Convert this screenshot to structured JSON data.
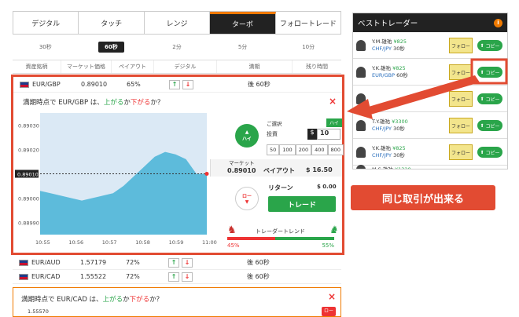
{
  "tabs": [
    "デジタル",
    "タッチ",
    "レンジ",
    "ターボ",
    "フォロートレード"
  ],
  "times": [
    "30秒",
    "60秒",
    "2分",
    "5分",
    "10分"
  ],
  "columns": [
    "資産銘柄",
    "マーケット価格",
    "ペイアウト",
    "デジタル",
    "満期",
    "残り時間"
  ],
  "main_row": {
    "pair": "EUR/GBP",
    "price": "0.89010",
    "payout": "65%",
    "expiry": "後 60秒"
  },
  "question": {
    "prefix": "満期時点で EUR/GBP は、",
    "up": "上がる",
    "mid": "か",
    "down": "下がる",
    "suffix": "か？"
  },
  "chart_data": {
    "type": "line",
    "x": [
      "10:55",
      "10:56",
      "10:57",
      "10:58",
      "10:59",
      "11:00"
    ],
    "yticks": [
      "0.89030",
      "0.89020",
      "0.89010",
      "0.89000",
      "0.88990"
    ],
    "current_label": "0.89010",
    "values": [
      0.89003,
      0.89002,
      0.89001,
      0.89,
      0.88999,
      0.89,
      0.89001,
      0.89002,
      0.89005,
      0.89009,
      0.89013,
      0.89017,
      0.89019,
      0.89018,
      0.89016,
      0.8901,
      0.8901
    ]
  },
  "market": {
    "label": "マーケット",
    "value": "0.89010"
  },
  "payout": {
    "label": "ペイアウト",
    "value": "$ 16.50"
  },
  "return": {
    "label": "リターン",
    "value": "$ 0.00"
  },
  "high_label": "ハイ",
  "low_label": "ロー",
  "select_label": "ご選択",
  "select_value": "ハイ",
  "invest_label": "投資",
  "invest_currency": "$",
  "invest_value": "10",
  "amounts": [
    "50",
    "100",
    "200",
    "400",
    "800"
  ],
  "trade_label": "トレード",
  "trend": {
    "label": "トレーダートレンド",
    "left": "45%",
    "right": "55%",
    "left_value": 0.45
  },
  "rows": [
    {
      "pair": "EUR/AUD",
      "price": "1.57179",
      "payout": "72%",
      "expiry": "後 60秒"
    },
    {
      "pair": "EUR/CAD",
      "price": "1.55522",
      "payout": "72%",
      "expiry": "後 60秒"
    }
  ],
  "lower_question": {
    "prefix": "満期時点で EUR/CAD は、",
    "up": "上がる",
    "mid": "か",
    "down": "下がる",
    "suffix": "か？",
    "price": "1.55570",
    "low": "ロー"
  },
  "best": {
    "title": "ベストトレーダー",
    "items": [
      {
        "name": "Y.M.雄祐",
        "profit": "¥825",
        "pair": "CHF/JPY",
        "duration": "30秒",
        "follow": "フォロー",
        "copy": "コピー"
      },
      {
        "name": "Y.K.雄祐",
        "profit": "¥825",
        "pair": "EUR/GBP",
        "duration": "60秒",
        "follow": "フォロー",
        "copy": "コピー"
      },
      {
        "name": "",
        "profit": "",
        "pair": "",
        "duration": "",
        "follow": "フォロー",
        "copy": "コピー"
      },
      {
        "name": "T.Y.雄祐",
        "profit": "¥3300",
        "pair": "CHF/JPY",
        "duration": "30秒",
        "follow": "フォロー",
        "copy": "コピー"
      },
      {
        "name": "Y.K.雄祐",
        "profit": "¥825",
        "pair": "CHF/JPY",
        "duration": "30秒",
        "follow": "フォロー",
        "copy": "コピー"
      },
      {
        "name": "M.S.雄祐",
        "profit": "¥1320",
        "pair": "",
        "duration": "",
        "follow": "",
        "copy": ""
      }
    ]
  },
  "callout": "同じ取引が出来る"
}
